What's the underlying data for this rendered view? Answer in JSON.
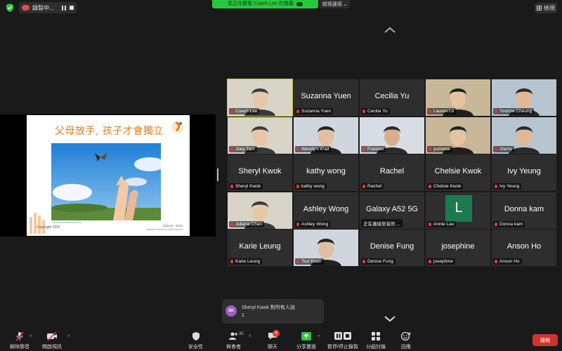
{
  "topbar": {
    "recording_label": "錄製中...",
    "viewing_banner": "您正在觀看 Coach Lee 的螢幕",
    "view_options_label": "檢視選項",
    "view_button_label": "檢視"
  },
  "slide": {
    "title": "父母放手, 孩子才會獨立",
    "copyright": "Copyright 2021",
    "url": "www.parentfree.com.hk",
    "credit_line1": "圖像來源：香港清",
    "credit_line2": "Alberta Parents for Child Careers"
  },
  "gallery": {
    "tiles": [
      {
        "label": "Coach Lee",
        "bigname": "",
        "video": true,
        "active": true
      },
      {
        "label": "Suzanna Yuen",
        "bigname": "Suzanna Yuen"
      },
      {
        "label": "Cecilia Yu",
        "bigname": "Cecilia Yu"
      },
      {
        "label": "Lauren Lo",
        "bigname": "",
        "video": true
      },
      {
        "label": "Yvonne Cheung",
        "bigname": "",
        "video": true
      },
      {
        "label": "Joey Tam",
        "bigname": "",
        "video": true
      },
      {
        "label": "Wendy's iPad",
        "bigname": "",
        "video": true
      },
      {
        "label": "Frances",
        "bigname": "",
        "video": true
      },
      {
        "label": "yumielai",
        "bigname": "",
        "video": true
      },
      {
        "label": "cherry",
        "bigname": "",
        "video": true
      },
      {
        "label": "Sheryl Kwok",
        "bigname": "Sheryl Kwok"
      },
      {
        "label": "kathy wong",
        "bigname": "kathy wong"
      },
      {
        "label": "Rachel",
        "bigname": "Rachel"
      },
      {
        "label": "Chelsie Kwok",
        "bigname": "Chelsie Kwok"
      },
      {
        "label": "Ivy Yeung",
        "bigname": "Ivy Yeung"
      },
      {
        "label": "Juliana Chan",
        "bigname": "",
        "video": true
      },
      {
        "label": "Ashley Wong",
        "bigname": "Ashley Wong"
      },
      {
        "label": "正在連接至音訊 ...",
        "bigname": "Galaxy A52 5G",
        "nomic": true
      },
      {
        "label": "Annie Lau",
        "bigname": "",
        "avatar": "L"
      },
      {
        "label": "Donna kam",
        "bigname": "Donna kam"
      },
      {
        "label": "Karie Leung",
        "bigname": "Karie Leung"
      },
      {
        "label": "Tsui Kuen",
        "bigname": "",
        "video": true
      },
      {
        "label": "Denise Fung",
        "bigname": "Denise Fung"
      },
      {
        "label": "josephine",
        "bigname": "josephine"
      },
      {
        "label": "Anson Ho",
        "bigname": "Anson Ho"
      }
    ]
  },
  "toast": {
    "avatar": "SK",
    "from": "Sheryl Kwok 對所有人說",
    "message": "1"
  },
  "toolbar": {
    "unmute": "解除靜音",
    "start_video": "開啟視訊",
    "security": "安全性",
    "participants": "與會者",
    "participants_count": "35",
    "chat": "聊天",
    "chat_badge": "4",
    "share_screen": "分享畫面",
    "pause_stop_recording": "暫停/停止錄製",
    "breakout_rooms": "分組討論",
    "reactions": "回應",
    "leave": "離開"
  },
  "colors": {
    "accent_green": "#27c83f",
    "active_speaker": "#b6ce3c",
    "leave_red": "#d0342c",
    "slide_title": "#e57b16"
  }
}
